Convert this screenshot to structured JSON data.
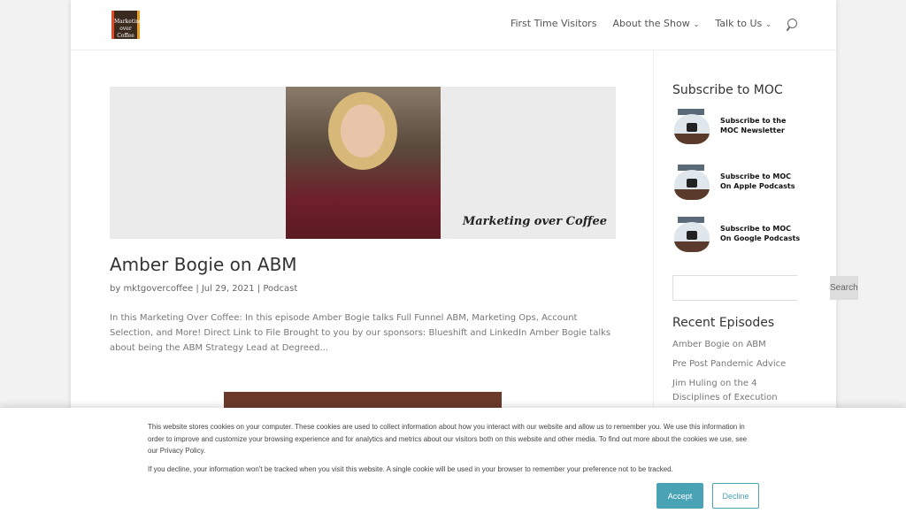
{
  "header": {
    "logo_text": "Marketing over Coffee",
    "nav": [
      {
        "label": "First Time Visitors"
      },
      {
        "label": "About the Show",
        "has_dropdown": true
      },
      {
        "label": "Talk to Us",
        "has_dropdown": true
      }
    ],
    "search_icon": "search-icon"
  },
  "post": {
    "image_brand": "Marketing over Coffee",
    "title": "Amber Bogie on ABM",
    "meta": "by mktgovercoffee | Jul 29, 2021 | Podcast",
    "excerpt": "In this Marketing Over Coffee: In this episode Amber Bogie talks Full Funnel ABM, Marketing Ops, Account Selection, and More! Direct Link to File Brought to you by our sponsors: Blueshift and LinkedIn Amber Bogie talks about being the ABM Strategy Lead at Degreed..."
  },
  "sidebar": {
    "subscribe_title": "Subscribe to MOC",
    "subscribe": [
      {
        "line1": "Subscribe to the",
        "line2": "MOC Newsletter",
        "icon": "envelope-icon"
      },
      {
        "line1": "Subscribe to MOC",
        "line2": "On Apple Podcasts",
        "icon": "podcast-icon"
      },
      {
        "line1": "Subscribe to MOC",
        "line2": "On Google Podcasts",
        "icon": "podcast-icon"
      }
    ],
    "search_value": "",
    "search_button": "Search",
    "recent_title": "Recent Episodes",
    "recent": [
      "Amber Bogie on ABM",
      "Pre Post Pandemic Advice",
      "Jim Huling on the 4 Disciplines of Execution"
    ]
  },
  "cookie": {
    "text1": "This website stores cookies on your computer. These cookies are used to collect information about how you interact with our website and allow us to remember you. We use this information in order to improve and customize your browsing experience and for analytics and metrics about our visitors both on this website and other media. To find out more about the cookies we use, see our Privacy Policy.",
    "text2": "If you decline, your information won't be tracked when you visit this website. A single cookie will be used in your browser to remember your preference not to be tracked.",
    "accept": "Accept",
    "decline": "Decline",
    "accent": "#4aa3b5"
  }
}
